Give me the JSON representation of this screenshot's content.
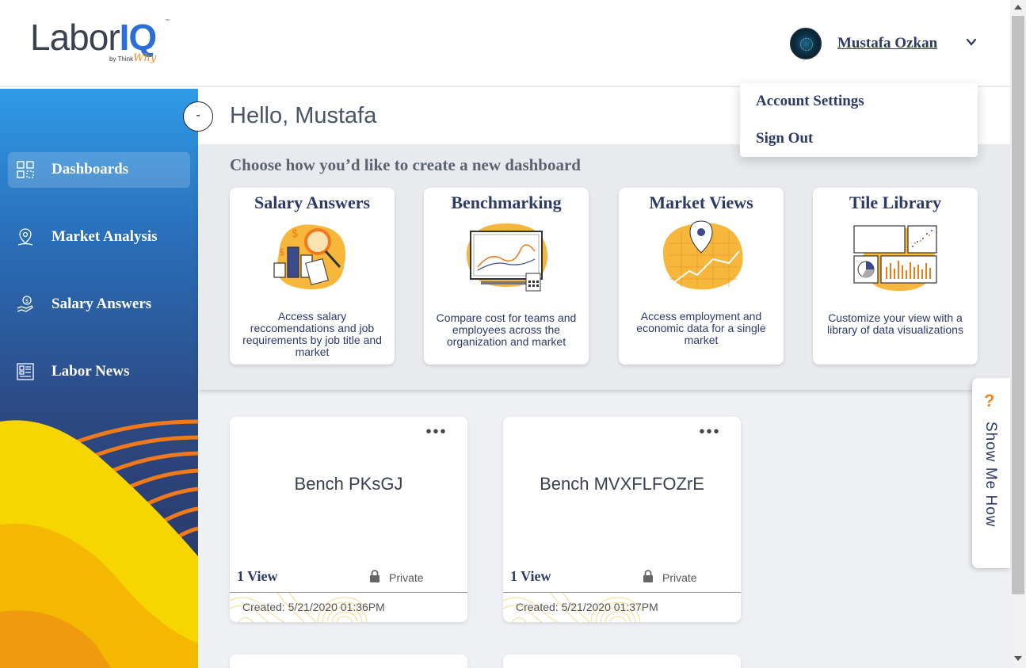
{
  "header": {
    "logo_text_a": "Labor",
    "logo_text_b": "IQ",
    "logo_tm": "™",
    "logo_by": "by Think",
    "logo_why": "Why",
    "user_name": "Mustafa Ozkan",
    "user_menu": [
      "Account Settings",
      "Sign Out"
    ]
  },
  "sidebar": {
    "items": [
      {
        "label": "Dashboards",
        "icon": "dashboard-grid-icon",
        "active": true
      },
      {
        "label": "Market Analysis",
        "icon": "map-pin-icon",
        "active": false
      },
      {
        "label": "Salary Answers",
        "icon": "money-hand-icon",
        "active": false
      },
      {
        "label": "Labor News",
        "icon": "newspaper-icon",
        "active": false
      }
    ]
  },
  "main": {
    "greeting": "Hello, Mustafa",
    "collapse_label": "-",
    "choose_title": "Choose how you’d like to create a new dashboard",
    "options": [
      {
        "title": "Salary Answers",
        "description": "Access salary reccomendations and job requirements by job title and market",
        "icon": "salary-magnifier-illustration"
      },
      {
        "title": "Benchmarking",
        "description": "Compare cost for teams and employees across the organization and market",
        "icon": "monitor-chart-illustration"
      },
      {
        "title": "Market Views",
        "description": "Access employment and economic data for a single market",
        "icon": "map-pin-chart-illustration"
      },
      {
        "title": "Tile Library",
        "description": "Customize your view with a library of data visualizations",
        "icon": "tile-grid-illustration"
      }
    ],
    "dashboards": [
      {
        "name": "Bench PKsGJ",
        "views": "1 View",
        "privacy": "Private",
        "created": "Created: 5/21/2020 01:36PM"
      },
      {
        "name": "Bench MVXFLFOZrE",
        "views": "1 View",
        "privacy": "Private",
        "created": "Created: 5/21/2020 01:37PM"
      }
    ],
    "menu_dots": "•••"
  },
  "help_tab": {
    "icon_text": "?",
    "label": "Show Me How"
  },
  "colors": {
    "navy": "#2b3a67",
    "accent_orange": "#f08a24",
    "accent_yellow": "#f5c400",
    "sidebar_top": "#2f9be8",
    "sidebar_bottom": "#2b3e70"
  }
}
